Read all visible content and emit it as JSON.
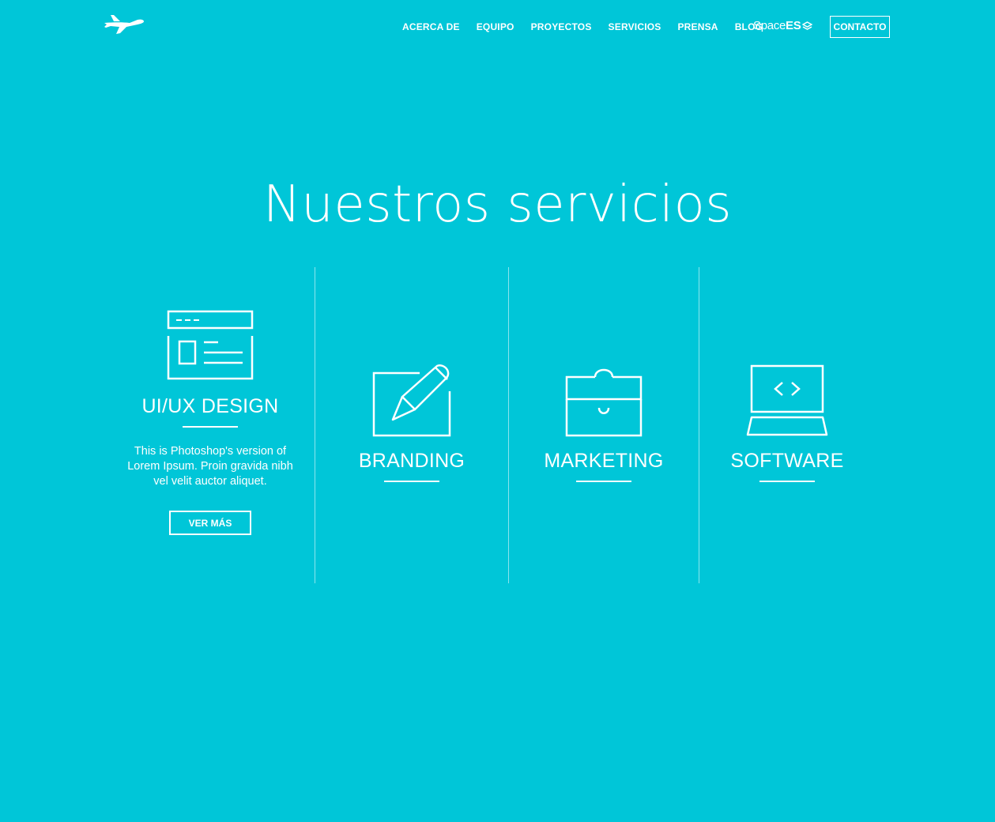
{
  "header": {
    "nav": [
      "ACERCA DE",
      "EQUIPO",
      "PROYECTOS",
      "SERVICIOS",
      "PRENSA",
      "BLOG"
    ],
    "partner": {
      "thin": "Space",
      "bold": "ES"
    },
    "contact_label": "CONTACTO"
  },
  "main": {
    "title": "Nuestros servicios",
    "services": [
      {
        "title": "UI/UX DESIGN",
        "icon": "browser-window-icon",
        "description": "This is Photoshop's version of Lorem Ipsum. Proin gravida nibh vel velit auctor aliquet.",
        "button": "VER MÁS"
      },
      {
        "title": "BRANDING",
        "icon": "edit-pencil-icon"
      },
      {
        "title": "MARKETING",
        "icon": "toolbox-icon"
      },
      {
        "title": "SOFTWARE",
        "icon": "laptop-code-icon"
      }
    ]
  },
  "colors": {
    "background": "#00c6d8",
    "foreground": "#ffffff"
  }
}
